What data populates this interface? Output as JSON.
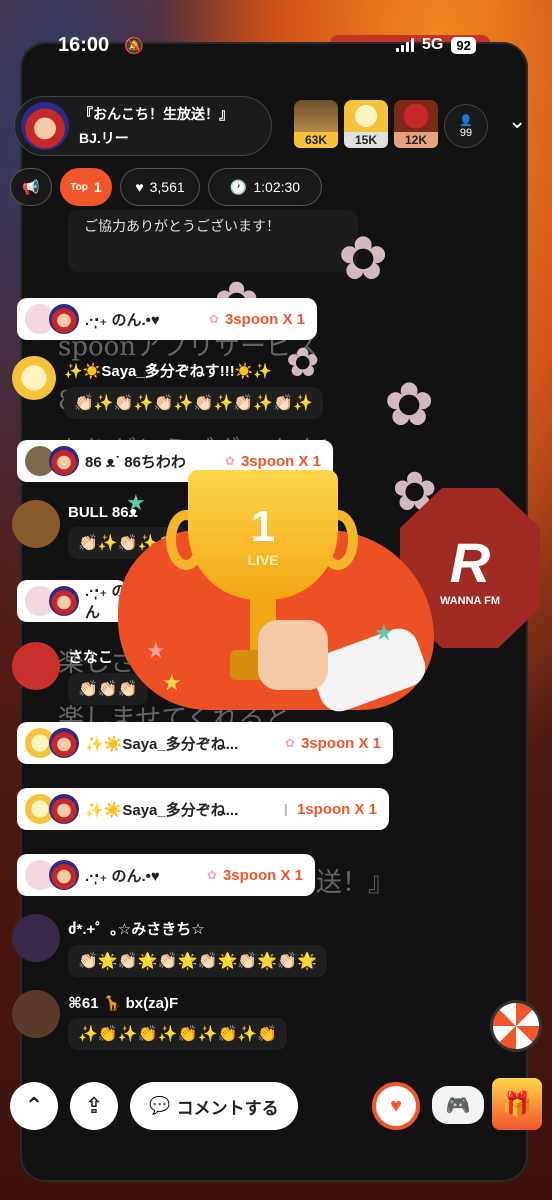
{
  "status_bar": {
    "time": "16:00",
    "network": "5G",
    "battery": "92"
  },
  "branding": {
    "logo_mark": "R",
    "logo_sub": "FM",
    "wanna_mark": "R",
    "wanna_label": "WANNA FM"
  },
  "host": {
    "title": "『おんこち！生放送！』",
    "name": "BJ.リー"
  },
  "top_listeners": [
    {
      "count": "63K",
      "color": "#f6c23a"
    },
    {
      "count": "15K",
      "color": "#e0e0e0"
    },
    {
      "count": "12K",
      "color": "#e3a37c"
    }
  ],
  "member_count": "99",
  "toolbar": {
    "top_label": "Top",
    "top_rank": "1",
    "likes": "3,561",
    "duration": "1:02:30"
  },
  "system_text": "ご協力ありがとうございます！",
  "faded_lines": [
    "spoonアプリサービス",
    "8周年！",
    "ありがとうございます！",
    "楽しさ",
    "楽しませてくれると",
    "送！』"
  ],
  "trophy": {
    "rank": "1",
    "label": "LIVE"
  },
  "chat": {
    "gift1": {
      "name": ".·‧̩̩₊ のん.•♥",
      "amount": "3spoon X 1"
    },
    "msg_saya": {
      "text": "✨☀️Saya_多分ぞねす!!!☀️✨",
      "emojis": "👏🏻✨👏🏻✨👏🏻✨👏🏻✨👏🏻✨👏🏻✨"
    },
    "gift2": {
      "name": "86 ᴥ˙ 86ちわわ",
      "amount": "3spoon X 1"
    },
    "msg_bull": {
      "name": "BULL 86ᴥ",
      "emojis": "👏🏻✨👏🏻✨👏🏻"
    },
    "gift3": {
      "name": ".·‧̩̩₊ のん",
      "amount": ""
    },
    "msg_sanako": {
      "name": "さなこ",
      "emojis": "👏🏻👏🏻👏🏻"
    },
    "gift4": {
      "name": "✨☀️Saya_多分ぞね...",
      "amount": "3spoon X 1"
    },
    "gift5": {
      "name": "✨☀️Saya_多分ぞね...",
      "amount": "1spoon X 1"
    },
    "gift6": {
      "name": ".·‧̩̩₊ のん.•♥",
      "amount": "3spoon X 1"
    },
    "msg_misaki": {
      "name": "ძ*.+゜｡☆みさきち☆",
      "emojis": "👏🏻🌟👏🏻🌟👏🏻🌟👏🏻🌟👏🏻🌟👏🏻🌟"
    },
    "msg_bx": {
      "name": "⌘61 🦒 bx(za)F",
      "emojis": "✨👏✨👏✨👏✨👏✨👏"
    }
  },
  "bottom": {
    "comment_label": "コメントする"
  },
  "colors": {
    "accent": "#f0562a",
    "frame": "#121212"
  }
}
